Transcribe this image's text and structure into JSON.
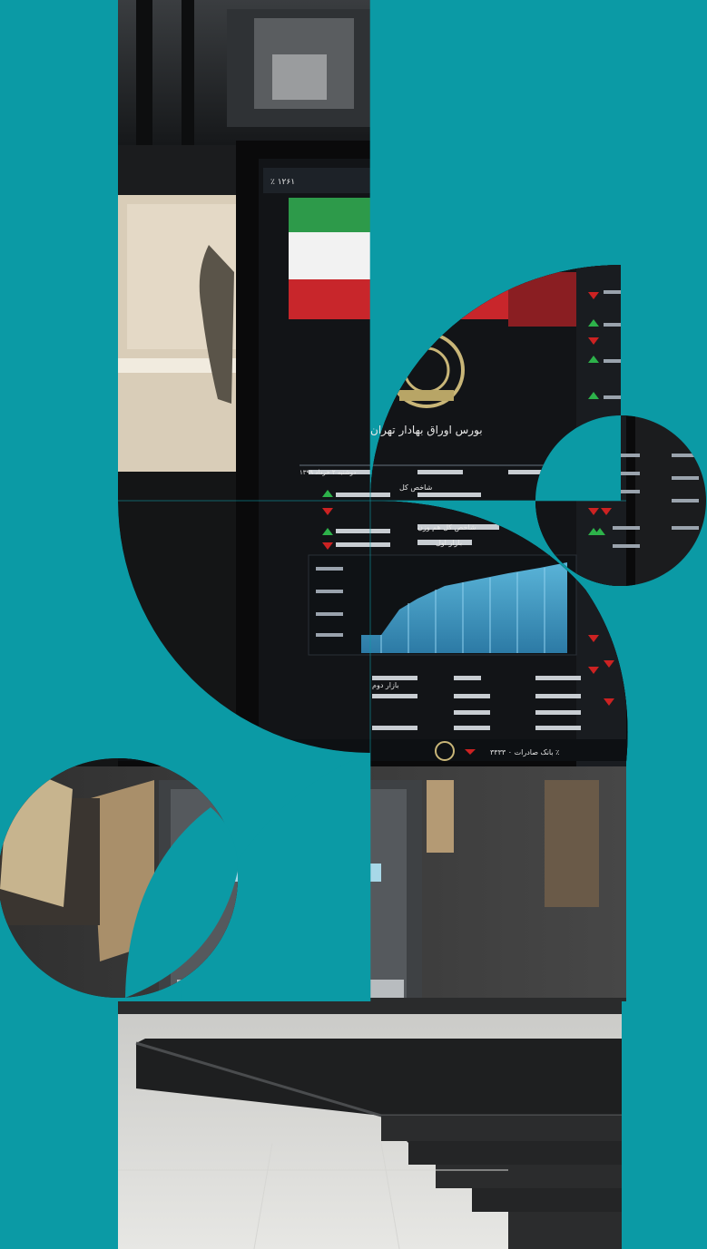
{
  "background_color": "#0b9aa5",
  "photo": {
    "subject": "stock-exchange-trading-board",
    "board_header_left": "٪ ۱۲۶۱",
    "board_date_label": "دوشنبه ۲ خرداد ۱۳۹۹",
    "board_logo_text": "بورس اوراق بهادار تهران",
    "board_row_labels": [
      "شاخص کل",
      "شاخص کل هم وزن",
      "بازار اول",
      "بازار دوم"
    ],
    "ticker_text": "بانک صادرات ۰ ۳۳۳۳ ٪"
  },
  "shapes": {
    "primary": "#0b9aa5",
    "icons": [
      "quarter-circle-shape",
      "leaf-shape",
      "circle-shape"
    ]
  }
}
